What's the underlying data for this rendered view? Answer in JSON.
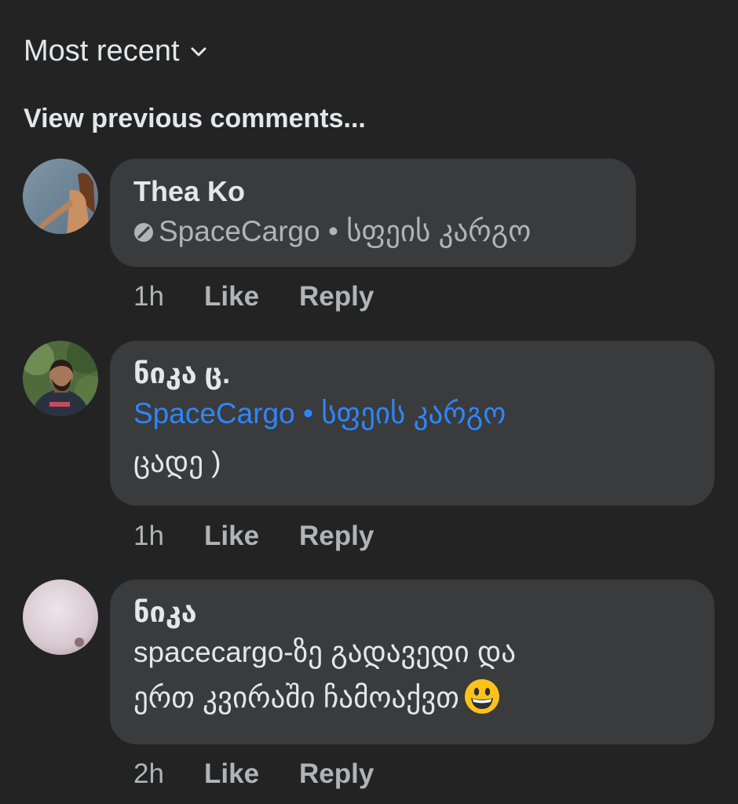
{
  "sort": {
    "label": "Most recent"
  },
  "view_previous": "View previous comments...",
  "comments": [
    {
      "author": "Thea Ko",
      "link_text": "SpaceCargo • სფეის კარგო",
      "time": "1h",
      "like": "Like",
      "reply": "Reply"
    },
    {
      "author": "ნიკა ც.",
      "link_text": "SpaceCargo • სფეის კარგო",
      "text": "ცადე )",
      "time": "1h",
      "like": "Like",
      "reply": "Reply"
    },
    {
      "author": "ნიკა",
      "text_line1": "spacecargo-ზე გადავედი და",
      "text_line2": "ერთ კვირაში ჩამოაქვთ",
      "emoji": "grinning-face-emoji",
      "time": "2h",
      "like": "Like",
      "reply": "Reply"
    }
  ],
  "colors": {
    "background": "#232324",
    "bubble": "#3a3b3c",
    "text_primary": "#e4e6eb",
    "text_secondary": "#b0b3b8",
    "link_blue": "#2d86ff"
  }
}
